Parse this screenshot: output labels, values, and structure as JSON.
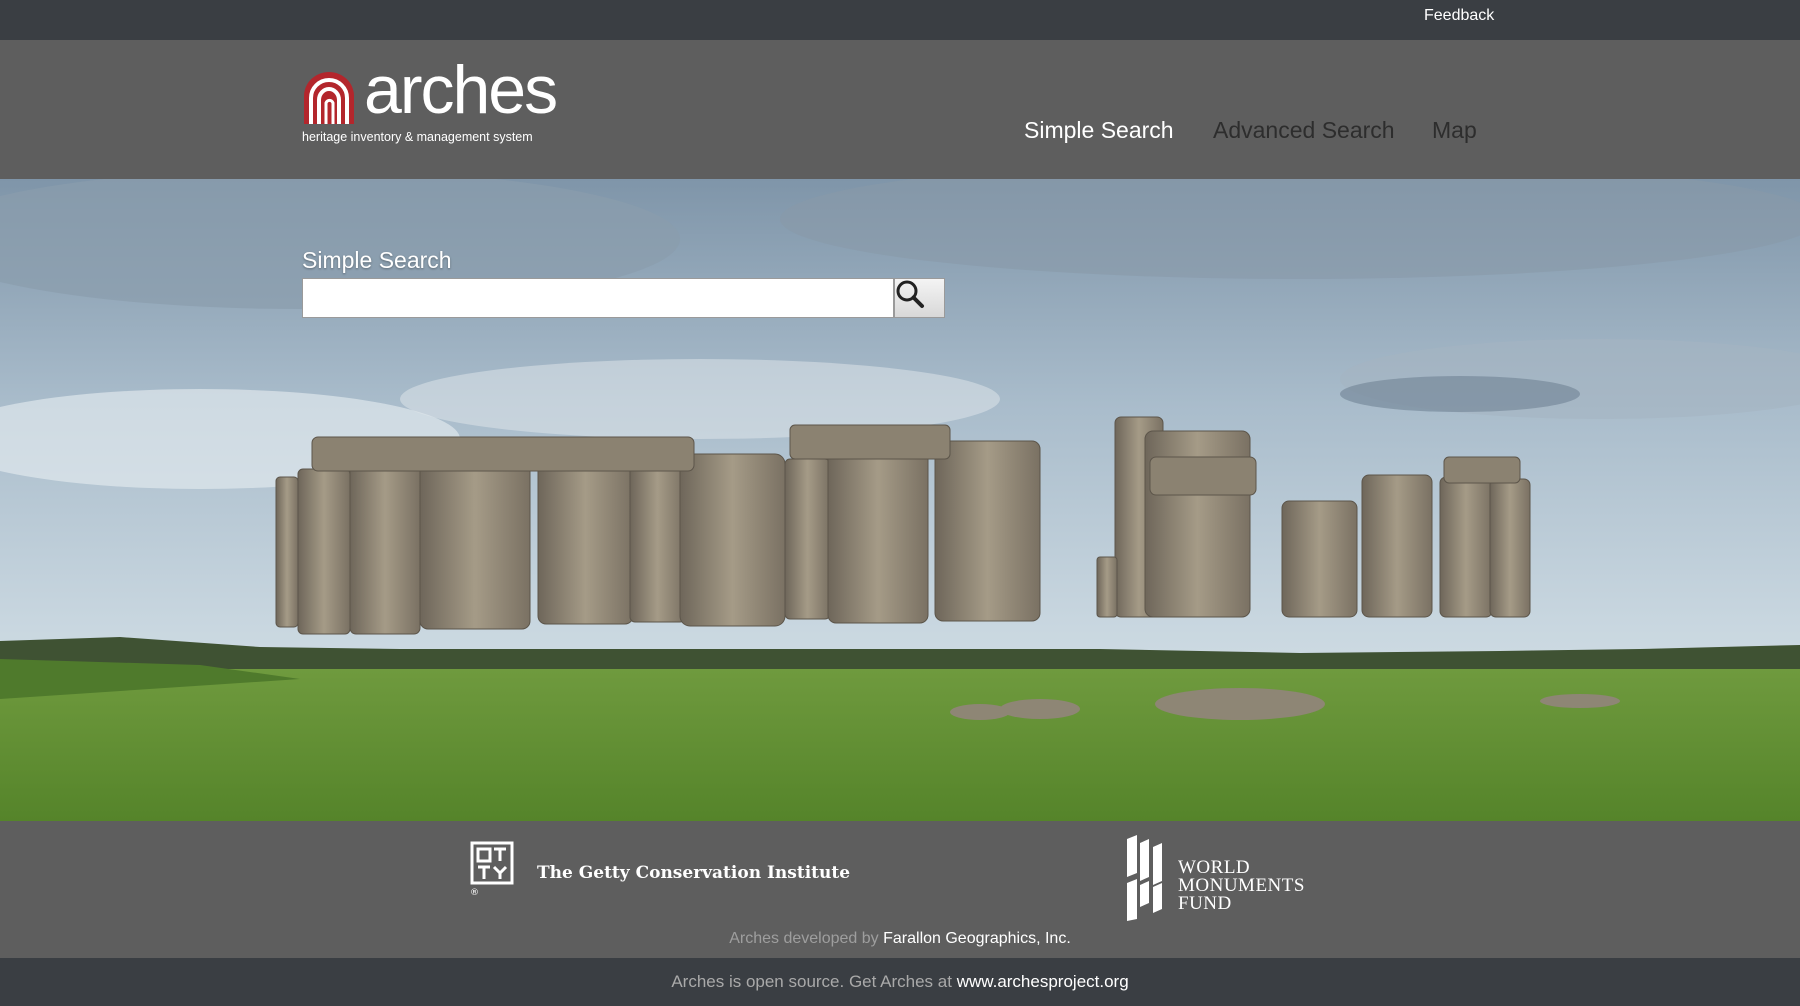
{
  "topbar": {
    "feedback_label": "Feedback"
  },
  "header": {
    "logo_word": "arches",
    "logo_tagline": "heritage inventory & management system",
    "nav": {
      "simple_search": "Simple Search",
      "advanced_search": "Advanced Search",
      "map": "Map"
    }
  },
  "hero": {
    "search_title": "Simple Search",
    "search_value": "",
    "search_icon": "magnifier-icon",
    "background": "stonehenge-landscape-photo"
  },
  "footer": {
    "getty_name": "The Getty Conservation Institute",
    "getty_mark": "GCI",
    "wmf_lines": [
      "WORLD",
      "MONUMENTS",
      "FUND"
    ],
    "credit_prefix": "Arches developed by",
    "credit_company": "Farallon Geographics, Inc."
  },
  "bottombar": {
    "open_source_text": "Arches is open source. Get Arches at",
    "project_url": "www.archesproject.org"
  },
  "colors": {
    "topbar": "#3a3e43",
    "header": "#5e5e5e",
    "logo_red": "#b3262c",
    "nav_active": "#ffffff",
    "nav_inactive": "#2d2d2d"
  }
}
